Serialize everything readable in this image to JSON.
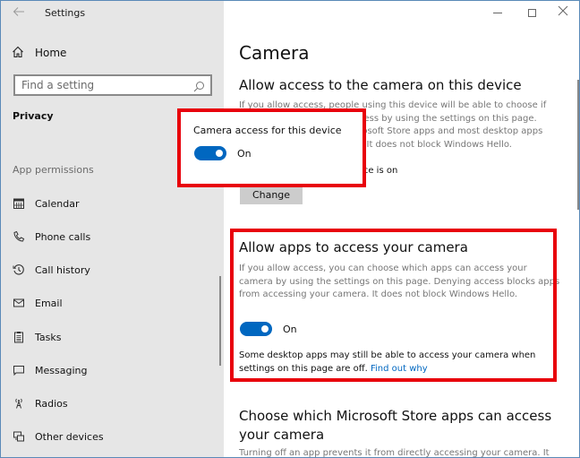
{
  "window": {
    "title": "Settings",
    "controls": {
      "minimize": "minimize",
      "maximize": "maximize",
      "close": "close"
    }
  },
  "sidebar": {
    "home_label": "Home",
    "search_placeholder": "Find a setting",
    "section_title": "Privacy",
    "group_title": "App permissions",
    "items": [
      {
        "label": "Calendar",
        "icon": "calendar-icon"
      },
      {
        "label": "Phone calls",
        "icon": "phone-icon"
      },
      {
        "label": "Call history",
        "icon": "history-icon"
      },
      {
        "label": "Email",
        "icon": "mail-icon"
      },
      {
        "label": "Tasks",
        "icon": "clipboard-icon"
      },
      {
        "label": "Messaging",
        "icon": "chat-icon"
      },
      {
        "label": "Radios",
        "icon": "radio-tower-icon"
      },
      {
        "label": "Other devices",
        "icon": "devices-icon"
      }
    ]
  },
  "main": {
    "page_title": "Camera",
    "device_section": {
      "heading": "Allow access to the camera on this device",
      "description": "If you allow access, people using this device will be able to choose if their apps have camera access by using the settings on this page. Denying access blocks Microsoft Store apps and most desktop apps from accessing the camera. It does not block Windows Hello.",
      "status": "Camera access for this device is on",
      "change_label": "Change"
    },
    "apps_section": {
      "heading": "Allow apps to access your camera",
      "description": "If you allow access, you can choose which apps can access your camera by using the settings on this page. Denying access blocks apps from accessing your camera. It does not block Windows Hello.",
      "toggle_state": "On",
      "toggle_on": true,
      "note": "Some desktop apps may still be able to access your camera when settings on this page are off.",
      "link": "Find out why"
    },
    "store_section": {
      "heading": "Choose which Microsoft Store apps can access your camera",
      "description": "Turning off an app prevents it from directly accessing your camera. It"
    }
  },
  "popup": {
    "label": "Camera access for this device",
    "toggle_state": "On",
    "toggle_on": true
  },
  "colors": {
    "accent": "#0067c0",
    "highlight": "#e8000b",
    "sidebar_bg": "#e6e6e6"
  }
}
